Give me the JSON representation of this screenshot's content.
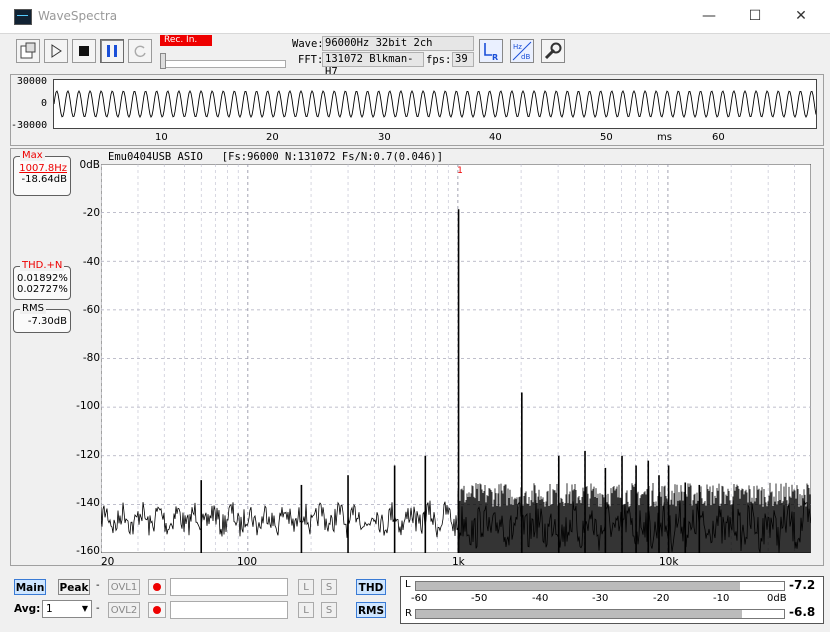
{
  "window": {
    "title": "WaveSpectra",
    "minimize": "—",
    "maximize": "☐",
    "close": "✕"
  },
  "toolbar": {
    "rec_label": "Rec. In.",
    "wave_label": "Wave:",
    "wave_value": "96000Hz 32bit 2ch",
    "fft_label": "FFT:",
    "fft_value": "131072 Blkman-H7",
    "fps_label": "fps:",
    "fps_value": "39",
    "lr_label": "L R",
    "hzdb_label": "Hz dB"
  },
  "wave": {
    "y_labels": [
      "30000",
      "0",
      "-30000"
    ],
    "x_ticks": [
      "10",
      "20",
      "30",
      "40",
      "50",
      "60"
    ],
    "x_unit": "ms"
  },
  "spectrum": {
    "device": "Emu0404USB ASIO",
    "params": "[Fs:96000 N:131072 Fs/N:0.7(0.046)]",
    "y_ticks": [
      "0dB",
      "-20",
      "-40",
      "-60",
      "-80",
      "-100",
      "-120",
      "-140",
      "-160"
    ],
    "x_ticks": [
      "20",
      "100",
      "1k",
      "10k"
    ],
    "marker": "1"
  },
  "chart_data": {
    "type": "line",
    "title": "",
    "xlabel": "",
    "ylabel": "",
    "x_scale": "log",
    "xlim": [
      20,
      48000
    ],
    "ylim": [
      -160,
      0
    ],
    "grid": true,
    "series": [
      {
        "peaks": [
          {
            "x": 1007.8,
            "y": -18.6
          },
          {
            "x": 2016,
            "y": -94
          },
          {
            "x": 3023,
            "y": -120
          },
          {
            "x": 4031,
            "y": -118
          },
          {
            "x": 5039,
            "y": -125
          },
          {
            "x": 6047,
            "y": -120
          },
          {
            "x": 7055,
            "y": -124
          },
          {
            "x": 8063,
            "y": -122
          },
          {
            "x": 9070,
            "y": -128
          },
          {
            "x": 10078,
            "y": -124
          },
          {
            "x": 12094,
            "y": -131
          },
          {
            "x": 14109,
            "y": -132
          },
          {
            "x": 60,
            "y": -130
          },
          {
            "x": 180,
            "y": -132
          },
          {
            "x": 300,
            "y": -128
          },
          {
            "x": 500,
            "y": -124
          },
          {
            "x": 700,
            "y": -120
          }
        ],
        "noise_floor_db": -143
      }
    ]
  },
  "readouts": {
    "max_label": "Max",
    "max_freq": "1007.8Hz",
    "max_level": "-18.64dB",
    "thd_label": "THD.+N",
    "thd_l": "0.01892%",
    "thd_r": "0.02727%",
    "rms_label": "RMS",
    "rms_value": "-7.30dB"
  },
  "bottom": {
    "main_label": "Main",
    "peak_label": "Peak",
    "avg_label": "Avg:",
    "avg_value": "1",
    "dash": "-",
    "ovl1": "OVL1",
    "ovl2": "OVL2",
    "l_btn": "L",
    "s_btn": "S",
    "thd_btn": "THD",
    "rms_btn": "RMS"
  },
  "meter": {
    "ch_l": "L",
    "ch_r": "R",
    "scale": [
      "-60",
      "-50",
      "-40",
      "-30",
      "-20",
      "-10",
      "0dB"
    ],
    "l_value": "-7.2",
    "r_value": "-6.8",
    "l_db": -7.2,
    "r_db": -6.8
  }
}
